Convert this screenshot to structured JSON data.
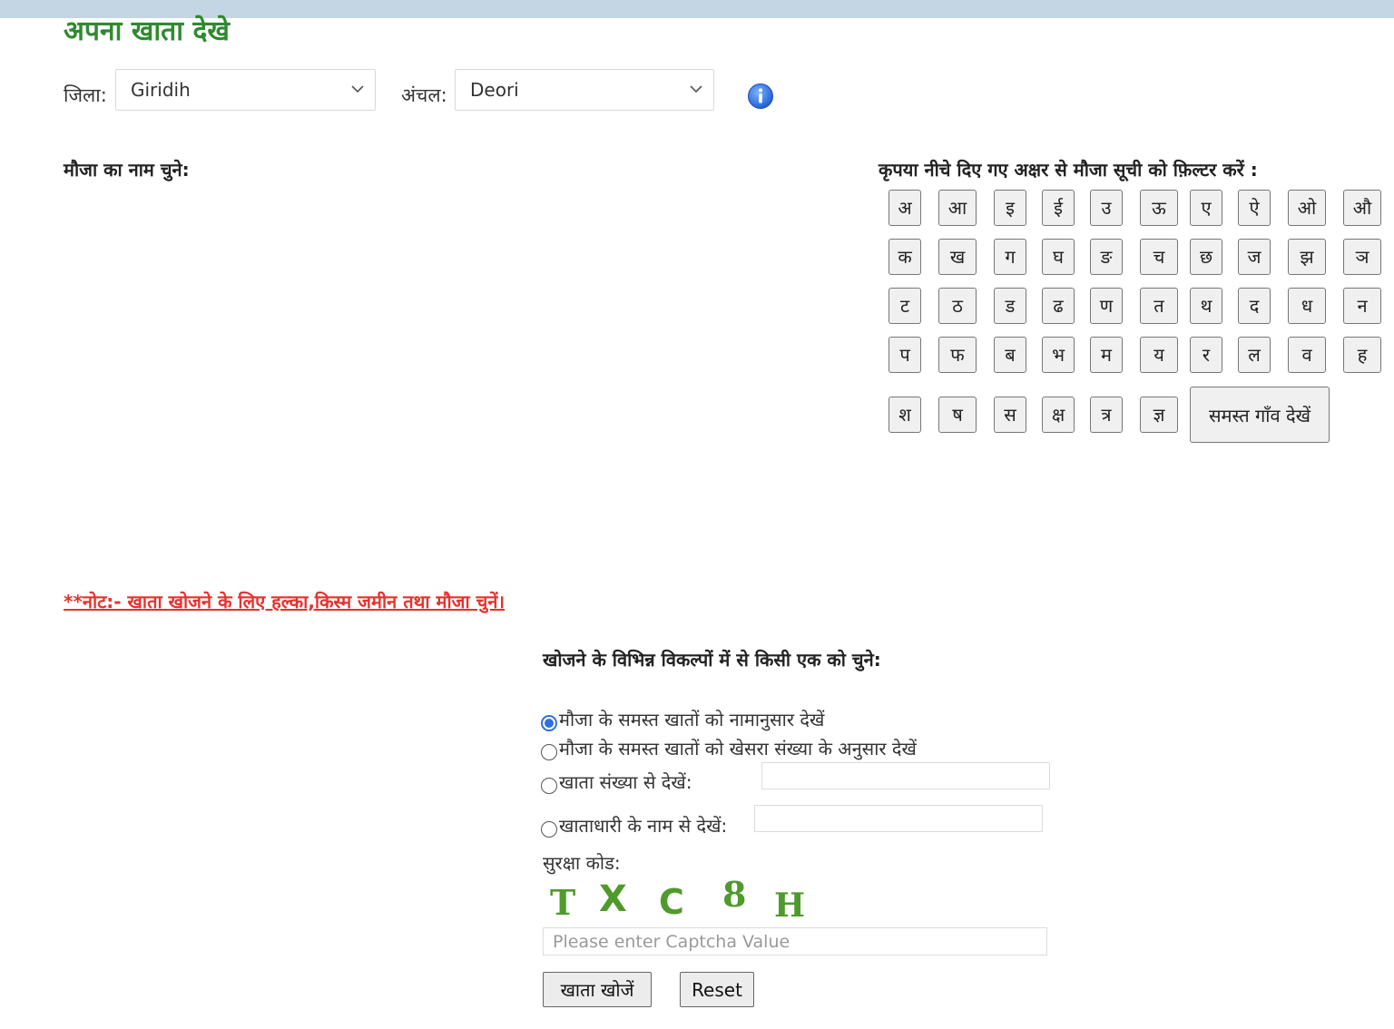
{
  "header": {
    "title": "अपना खाता देखे"
  },
  "filters": {
    "district_label": "जिला:",
    "district_value": "Giridih",
    "circle_label": "अंचल:",
    "circle_value": "Deori",
    "info_icon": "info-icon"
  },
  "mauza": {
    "heading": "मौजा का नाम चुने:",
    "filter_heading": "कृपया नीचे दिए गए अक्षर से मौजा सूची को फ़िल्टर करें :",
    "letters": [
      [
        "अ",
        "आ",
        "इ",
        "ई",
        "उ",
        "ऊ",
        "ए",
        "ऐ",
        "ओ",
        "औ"
      ],
      [
        "क",
        "ख",
        "ग",
        "घ",
        "ङ",
        "च",
        "छ",
        "ज",
        "झ",
        "ञ"
      ],
      [
        "ट",
        "ठ",
        "ड",
        "ढ",
        "ण",
        "त",
        "थ",
        "द",
        "ध",
        "न"
      ],
      [
        "प",
        "फ",
        "ब",
        "भ",
        "म",
        "य",
        "र",
        "ल",
        "व",
        "ह"
      ],
      [
        "श",
        "ष",
        "स",
        "क्ष",
        "त्र",
        "ज्ञ"
      ]
    ],
    "all_villages_label": "समस्त गाँव देखें"
  },
  "note": {
    "text": "**नोट:- खाता खोजने के लिए हल्का,किस्म जमीन तथा मौजा चुनें।"
  },
  "search": {
    "heading": "खोजने के विभिन्न विकल्पों में से किसी एक को चुने:",
    "options": [
      {
        "label": "मौजा के समस्त खातों को नामानुसार देखें",
        "checked": true
      },
      {
        "label": "मौजा के समस्त खातों को खेसरा संख्या के अनुसार देखें",
        "checked": false
      },
      {
        "label": "खाता संख्या से देखें:",
        "checked": false
      },
      {
        "label": "खाताधारी के नाम से देखें:",
        "checked": false
      }
    ],
    "khata_number_value": "",
    "owner_name_value": ""
  },
  "captcha": {
    "label": "सुरक्षा कोड:",
    "chars": [
      "T",
      "X",
      "C",
      "8",
      "H"
    ],
    "color": "#4f9a2c",
    "placeholder": "Please enter Captcha Value",
    "value": ""
  },
  "actions": {
    "search_label": "खाता खोजें",
    "reset_label": "Reset"
  }
}
